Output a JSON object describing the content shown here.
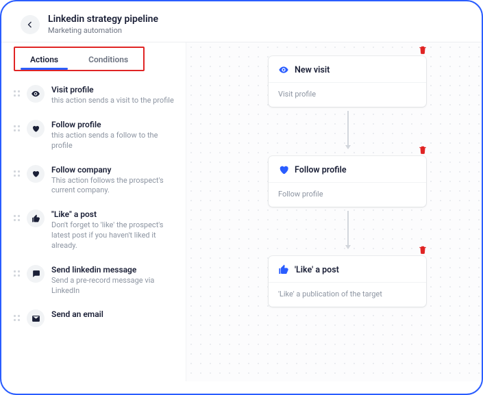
{
  "header": {
    "title": "Linkedin strategy pipeline",
    "subtitle": "Marketing automation"
  },
  "tabs": {
    "actions": "Actions",
    "conditions": "Conditions"
  },
  "actions": [
    {
      "icon": "eye",
      "title": "Visit profile",
      "desc": "this action sends a visit to the profile"
    },
    {
      "icon": "heart",
      "title": "Follow profile",
      "desc": "this action sends a follow to the profile"
    },
    {
      "icon": "heart",
      "title": "Follow company",
      "desc": "This action follows the prospect's current company."
    },
    {
      "icon": "thumb",
      "title": "\"Like\" a post",
      "desc": "Don't forget to 'like' the prospect's latest post if you haven't liked it already."
    },
    {
      "icon": "message",
      "title": "Send linkedin message",
      "desc": "Send a pre-record message via LinkedIn"
    },
    {
      "icon": "mail",
      "title": "Send an email",
      "desc": ""
    }
  ],
  "nodes": [
    {
      "icon": "eye",
      "title": "New visit",
      "body": "Visit profile"
    },
    {
      "icon": "heart",
      "title": "Follow profile",
      "body": "Follow profile"
    },
    {
      "icon": "thumb",
      "title": "'Like' a post",
      "body": "'Like' a publication of the target"
    }
  ]
}
